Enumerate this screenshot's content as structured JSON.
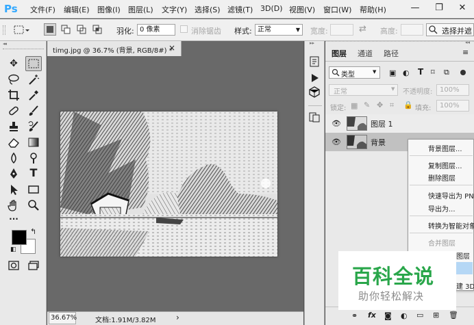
{
  "app": {
    "logo": "Ps"
  },
  "menu": [
    "文件(F)",
    "编辑(E)",
    "图像(I)",
    "图层(L)",
    "文字(Y)",
    "选择(S)",
    "滤镜(T)",
    "3D(D)",
    "视图(V)",
    "窗口(W)",
    "帮助(H)"
  ],
  "window_controls": {
    "minimize": "—",
    "restore": "❐",
    "close": "✕"
  },
  "options": {
    "feather_label": "羽化:",
    "feather_value": "0 像素",
    "antialias_label": "消除锯齿",
    "style_label": "样式:",
    "style_value": "正常",
    "width_label": "宽度:",
    "height_label": "高度:",
    "select_mask_label": "选择并遮"
  },
  "document": {
    "tab_title": "timg.jpg @ 36.7% (背景, RGB/8#) *",
    "close_glyph": "×",
    "zoom": "36.67%",
    "doc_info": "文档:1.91M/3.82M",
    "status_arrow": "›"
  },
  "toolbox": {
    "text_tool_glyph": "T",
    "more_glyph": "···"
  },
  "layers_panel": {
    "tabs": [
      "图层",
      "通道",
      "路径"
    ],
    "filter_label": "类型",
    "blend_mode": "正常",
    "opacity_label": "不透明度:",
    "opacity_value": "100%",
    "lock_label": "锁定:",
    "fill_label": "填充:",
    "fill_value": "100%",
    "layers": [
      {
        "name": "图层 1"
      },
      {
        "name": "背景"
      }
    ],
    "bottom_icons": [
      "link-icon",
      "fx-icon",
      "mask-icon",
      "adjustment-icon",
      "folder-icon",
      "new-layer-icon",
      "trash-icon"
    ]
  },
  "context_menu": {
    "items": [
      {
        "label": "背景图层...",
        "enabled": true
      },
      {
        "label": "复制图层...",
        "enabled": true
      },
      {
        "label": "删除图层",
        "enabled": true
      },
      {
        "label": "快速导出为 PN",
        "enabled": true
      },
      {
        "label": "导出为...",
        "enabled": true
      },
      {
        "label": "转换为智能对象",
        "enabled": true
      },
      {
        "label": "合并图层",
        "enabled": false
      },
      {
        "label": "图层",
        "enabled": true
      },
      {
        "label": "建 3D",
        "enabled": true
      }
    ]
  },
  "watermark": {
    "title": "百科全说",
    "subtitle": "助你轻松解决"
  },
  "colors": {
    "ps_blue": "#31a8ff",
    "watermark_green": "#29a64a",
    "menu_highlight": "#b5d7f5"
  }
}
